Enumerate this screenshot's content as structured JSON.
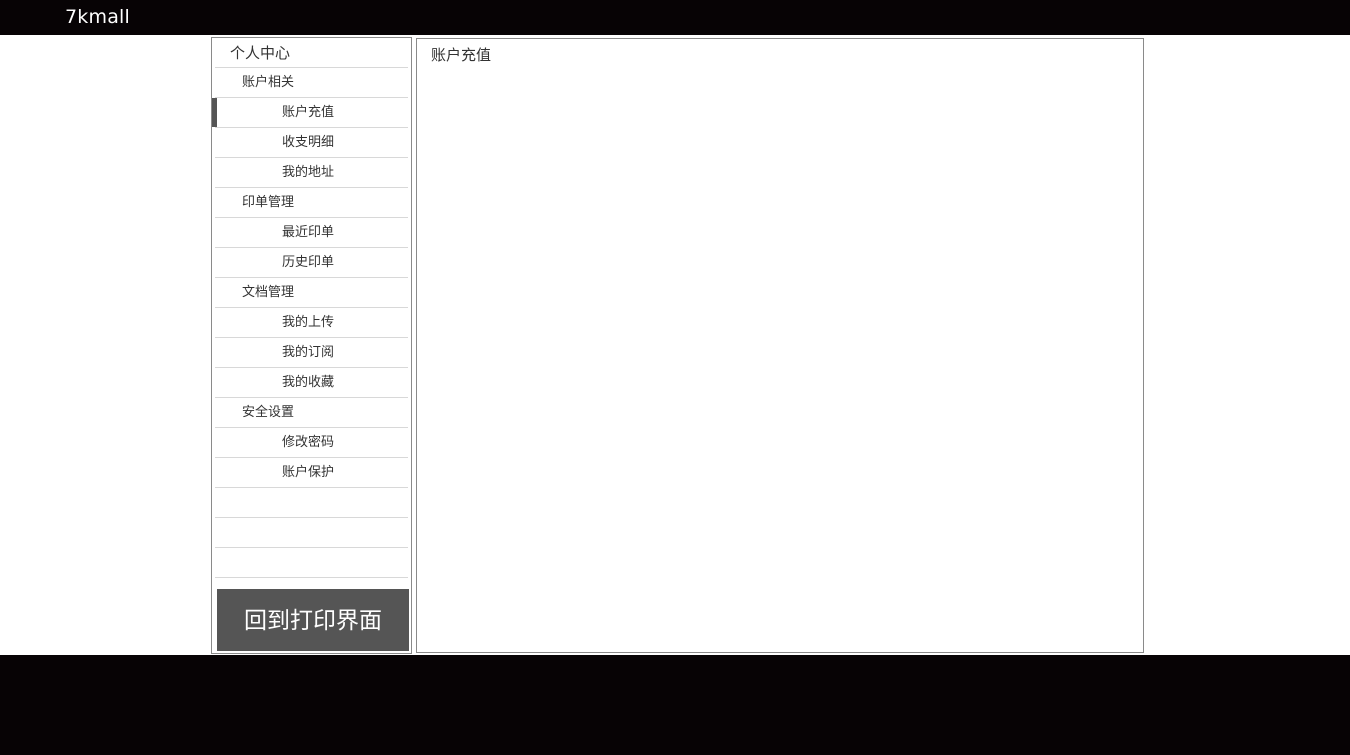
{
  "header": {
    "logo_text": "7kmall"
  },
  "sidebar": {
    "title": "个人中心",
    "items": [
      {
        "label": "账户相关",
        "level": "group"
      },
      {
        "label": "账户充值",
        "level": "sub",
        "active": true
      },
      {
        "label": "收支明细",
        "level": "sub"
      },
      {
        "label": "我的地址",
        "level": "sub"
      },
      {
        "label": "印单管理",
        "level": "group"
      },
      {
        "label": "最近印单",
        "level": "sub"
      },
      {
        "label": "历史印单",
        "level": "sub"
      },
      {
        "label": "文档管理",
        "level": "group"
      },
      {
        "label": "我的上传",
        "level": "sub"
      },
      {
        "label": "我的订阅",
        "level": "sub"
      },
      {
        "label": "我的收藏",
        "level": "sub"
      },
      {
        "label": "安全设置",
        "level": "group"
      },
      {
        "label": "修改密码",
        "level": "sub"
      },
      {
        "label": "账户保护",
        "level": "sub"
      },
      {
        "label": "",
        "level": "empty"
      },
      {
        "label": "",
        "level": "empty"
      },
      {
        "label": "",
        "level": "empty"
      }
    ],
    "back_button_label": "回到打印界面"
  },
  "main": {
    "title": "账户充值"
  },
  "colors": {
    "header_bg": "#070305",
    "footer_bg": "#070305",
    "button_bg": "#555555",
    "active_marker": "#555555",
    "border": "#8a8a8a"
  }
}
